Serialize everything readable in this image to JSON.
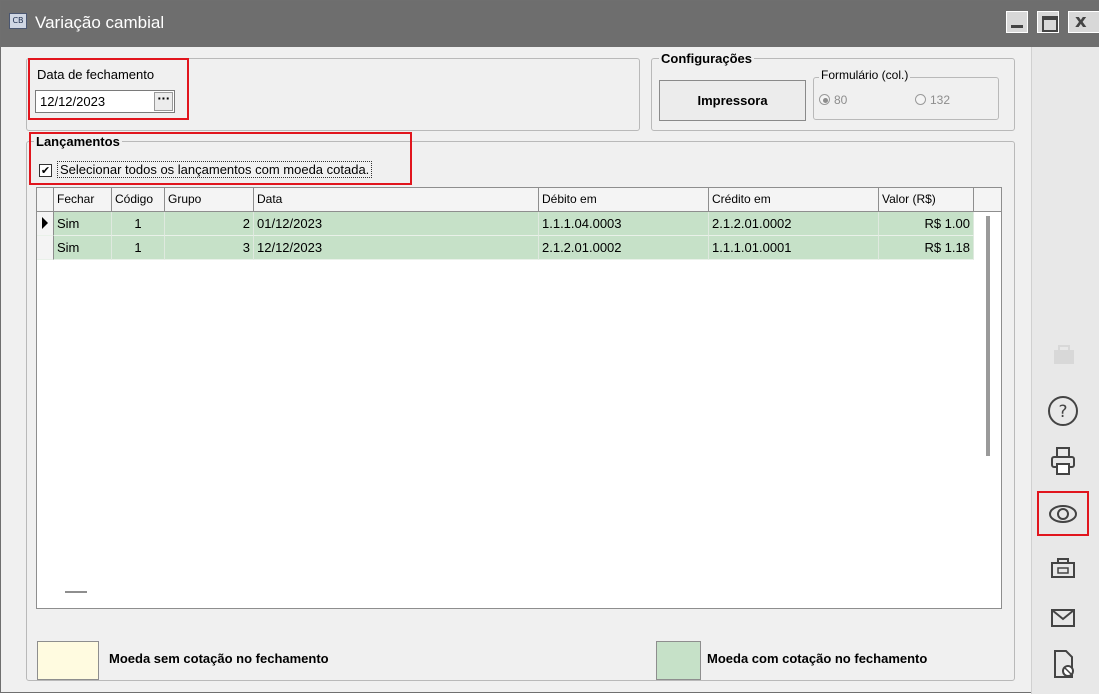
{
  "window": {
    "title": "Variação cambial",
    "app_icon": "CB"
  },
  "date_group": {
    "label": "Data de fechamento",
    "value": "12/12/2023",
    "button": "···"
  },
  "config": {
    "label": "Configurações",
    "print_button": "Impressora",
    "form_label": "Formulário (col.)",
    "options": [
      "80",
      "132"
    ],
    "selected": "80"
  },
  "lancamentos": {
    "label": "Lançamentos",
    "select_all": "Selecionar todos os lançamentos com moeda cotada.",
    "checked": true
  },
  "grid": {
    "columns": [
      "Fechar",
      "Código",
      "Grupo",
      "Data",
      "Débito em",
      "Crédito em",
      "Valor (R$)"
    ],
    "rows": [
      {
        "fechar": "Sim",
        "codigo": "1",
        "grupo": "2",
        "data": "01/12/2023",
        "debito": "1.1.1.04.0003",
        "credito": "2.1.2.01.0002",
        "valor": "R$ 1.00"
      },
      {
        "fechar": "Sim",
        "codigo": "1",
        "grupo": "3",
        "data": "12/12/2023",
        "debito": "2.1.2.01.0002",
        "credito": "1.1.1.01.0001",
        "valor": "R$ 1.18"
      }
    ]
  },
  "legend": {
    "left": "Moeda sem cotação no fechamento",
    "right": "Moeda com cotação no fechamento",
    "left_color": "#fffbe0",
    "right_color": "#c6e1c8"
  },
  "sidebar": {
    "icons": [
      "briefcase-icon",
      "help-icon",
      "printer-icon",
      "preview-eye-icon",
      "camera-icon",
      "mail-icon",
      "document-delete-icon"
    ]
  },
  "colors": {
    "highlight": "#e1151d",
    "titlebar": "#6e6e6e"
  }
}
